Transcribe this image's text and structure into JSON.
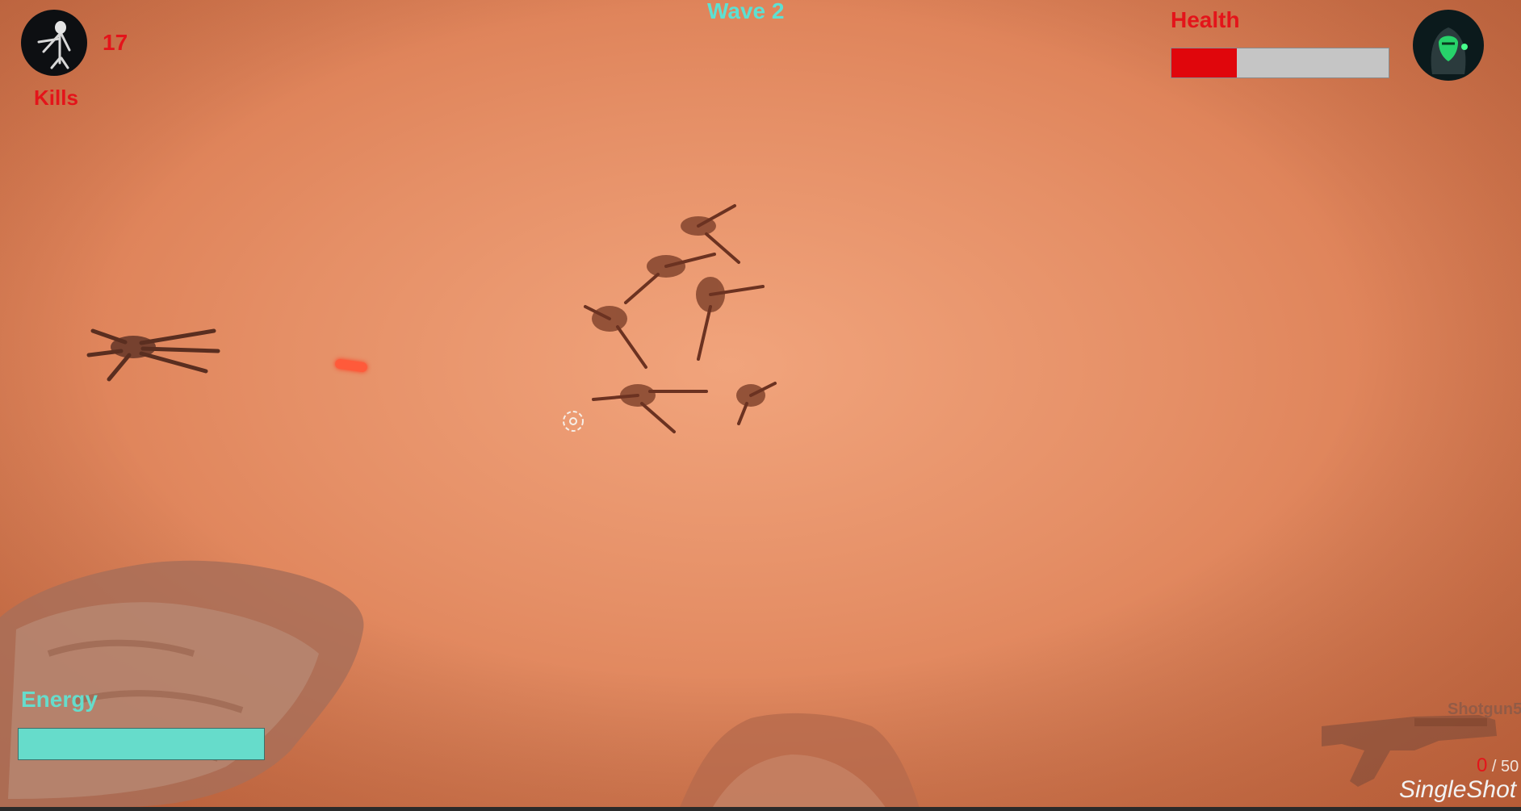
{
  "hud": {
    "wave_label": "Wave 2",
    "kills_count": "17",
    "kills_label": "Kills",
    "health_label": "Health",
    "health_fraction": 0.3,
    "energy_label": "Energy",
    "energy_fraction": 1.0,
    "weapon_name": "Shotgun5",
    "ammo_current": "0",
    "ammo_total": "/ 50",
    "fire_mode": "SingleShot"
  },
  "colors": {
    "health_fill": "#e0060c",
    "health_empty": "#c5c5c5",
    "energy_fill": "#66dccb",
    "hud_red": "#e4141a",
    "hud_cyan": "#5de0d2",
    "ground": "#e58f66"
  },
  "icons": {
    "kills": "alien-creature-icon",
    "player": "armored-soldier-portrait-icon",
    "weapon": "shotgun-icon",
    "crosshair": "crosshair-icon"
  }
}
